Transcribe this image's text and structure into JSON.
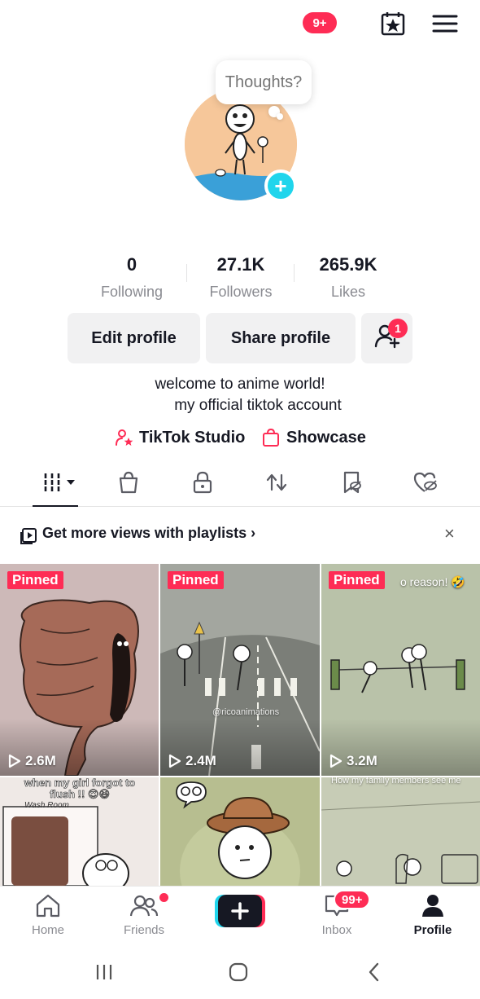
{
  "header": {
    "notification_badge": "9+"
  },
  "profile": {
    "thought_bubble": "Thoughts?",
    "add_button": "+"
  },
  "stats": [
    {
      "value": "0",
      "label": "Following"
    },
    {
      "value": "27.1K",
      "label": "Followers"
    },
    {
      "value": "265.9K",
      "label": "Likes"
    }
  ],
  "actions": {
    "edit_profile": "Edit profile",
    "share_profile": "Share profile",
    "add_friend_badge": "1"
  },
  "bio": {
    "line1": "welcome to anime world!",
    "line2": "my official tiktok account"
  },
  "links": {
    "studio": "TikTok Studio",
    "showcase": "Showcase"
  },
  "tabs": [
    "videos",
    "shop",
    "private",
    "reposts",
    "favorites",
    "liked"
  ],
  "playlist_banner": {
    "text": "Get more views with playlists",
    "chevron": "›",
    "close": "×"
  },
  "videos": [
    {
      "pinned": "Pinned",
      "views": "2.6M",
      "overlay": ""
    },
    {
      "pinned": "Pinned",
      "views": "2.4M",
      "overlay": "@ricoanimations"
    },
    {
      "pinned": "Pinned",
      "views": "3.2M",
      "overlay": "o reason! 🤣"
    },
    {
      "pinned": "",
      "views": "",
      "overlay": "when my girl forgot to flush !! 😍😆"
    },
    {
      "pinned": "",
      "views": "",
      "overlay": ""
    },
    {
      "pinned": "",
      "views": "",
      "overlay": "How my family members see me"
    }
  ],
  "bottom_nav": {
    "home": "Home",
    "friends": "Friends",
    "create": "+",
    "inbox": "Inbox",
    "inbox_badge": "99+",
    "profile": "Profile"
  },
  "colors": {
    "accent": "#fe2c55",
    "cyan": "#20d5ec",
    "text": "#161823",
    "muted": "#8a8b91"
  }
}
